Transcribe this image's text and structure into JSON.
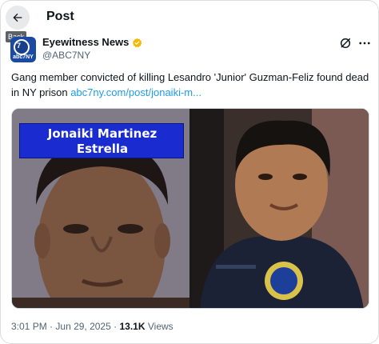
{
  "header": {
    "title": "Post",
    "back_tooltip": "Back"
  },
  "account": {
    "name": "Eyewitness News",
    "handle": "@ABC7NY",
    "avatar_text": "7",
    "avatar_subtext": "abc7NY",
    "verified_color": "#f5b800"
  },
  "tweet": {
    "text": "Gang member convicted of killing Lesandro 'Junior' Guzman-Feliz found dead in NY prison ",
    "link": "abc7ny.com/post/jonaiki-m..."
  },
  "media": {
    "left_caption_line1": "Jonaiki Martinez",
    "left_caption_line2": "Estrella"
  },
  "meta": {
    "time": "3:01 PM",
    "separator": "·",
    "date": "Jun 29, 2025",
    "views_count": "13.1K",
    "views_label": "Views"
  },
  "colors": {
    "link": "#1d9bf0",
    "banner": "#1a2bd0",
    "secondary_text": "#536471"
  }
}
